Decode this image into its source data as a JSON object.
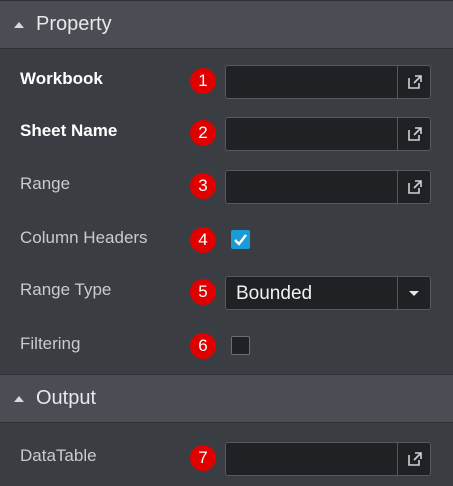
{
  "property_section": {
    "title": "Property"
  },
  "output_section": {
    "title": "Output"
  },
  "rows": [
    {
      "label": "Workbook",
      "badge": "1",
      "value": ""
    },
    {
      "label": "Sheet Name",
      "badge": "2",
      "value": ""
    },
    {
      "label": "Range",
      "badge": "3",
      "value": ""
    },
    {
      "label": "Column Headers",
      "badge": "4",
      "checked": true
    },
    {
      "label": "Range Type",
      "badge": "5",
      "selected": "Bounded"
    },
    {
      "label": "Filtering",
      "badge": "6",
      "checked": false
    }
  ],
  "output_rows": [
    {
      "label": "DataTable",
      "badge": "7",
      "value": ""
    }
  ],
  "icons": {
    "section_toggle": "caret-up-icon",
    "field_action": "open-external-icon",
    "dropdown": "chevron-down-icon",
    "checkbox_checked": "check-icon"
  },
  "colors": {
    "badge": "#e00000",
    "checkbox_on": "#1a9bd7"
  }
}
